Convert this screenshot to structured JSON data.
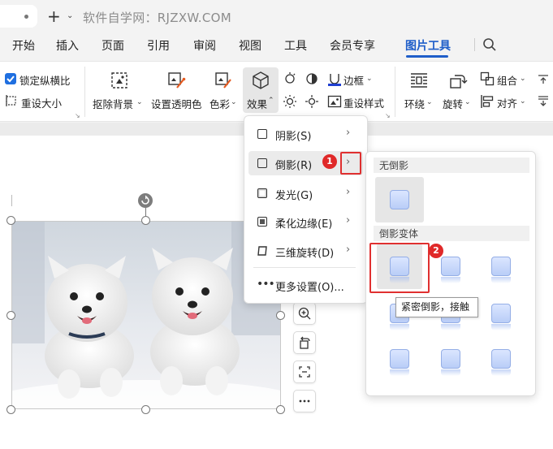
{
  "titlebar": {
    "site_title": "软件自学网：RJZXW.COM"
  },
  "menu": {
    "items": [
      "开始",
      "插入",
      "页面",
      "引用",
      "审阅",
      "视图",
      "工具",
      "会员专享",
      "图片工具"
    ],
    "active": "图片工具"
  },
  "ribbon": {
    "lock_ratio": "锁定纵横比",
    "reset_size": "重设大小",
    "remove_bg": "抠除背景",
    "set_transparent": "设置透明色",
    "color": "色彩",
    "effects": "效果",
    "border": "边框",
    "reset_style": "重设样式",
    "wrap": "环绕",
    "rotate": "旋转",
    "group": "组合",
    "align": "对齐"
  },
  "effects_menu": {
    "items": [
      {
        "label": "阴影(S)",
        "has_submenu": true
      },
      {
        "label": "倒影(R)",
        "has_submenu": true
      },
      {
        "label": "发光(G)",
        "has_submenu": true
      },
      {
        "label": "柔化边缘(E)",
        "has_submenu": true
      },
      {
        "label": "三维旋转(D)",
        "has_submenu": true
      }
    ],
    "more": "更多设置(O)..."
  },
  "reflection_gallery": {
    "none_section": "无倒影",
    "variants_section": "倒影变体",
    "tooltip": "紧密倒影，接触"
  },
  "annotations": {
    "badge1": "1",
    "badge2": "2"
  },
  "colors": {
    "accent": "#1f5ec9",
    "marker": "#e02929"
  }
}
